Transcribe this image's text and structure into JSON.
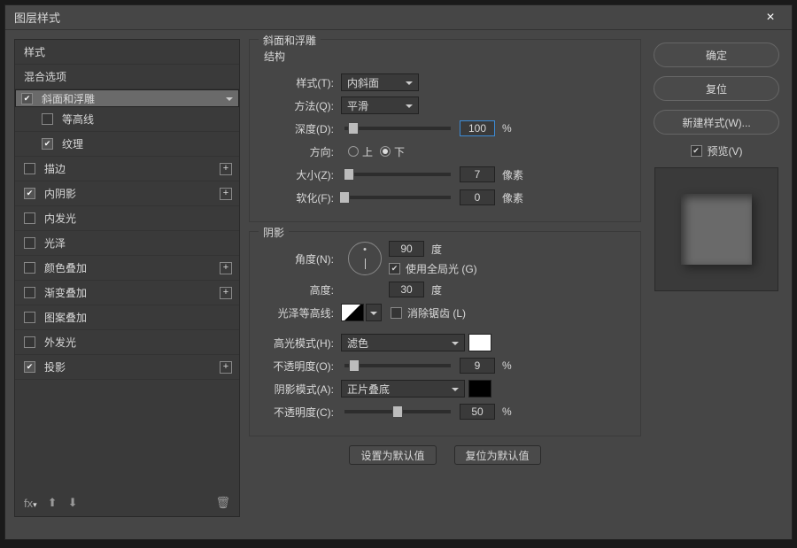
{
  "dialog": {
    "title": "图层样式"
  },
  "left": {
    "style": "样式",
    "blend": "混合选项",
    "bevel": "斜面和浮雕",
    "contour": "等高线",
    "texture": "纹理",
    "stroke": "描边",
    "innerShadow": "内阴影",
    "innerGlow": "内发光",
    "satin": "光泽",
    "colorOverlay": "颜色叠加",
    "gradOverlay": "渐变叠加",
    "pattOverlay": "图案叠加",
    "outerGlow": "外发光",
    "dropShadow": "投影"
  },
  "mid": {
    "groupTitle": "斜面和浮雕",
    "structTitle": "结构",
    "styleLabel": "样式(T):",
    "styleVal": "内斜面",
    "methodLabel": "方法(Q):",
    "methodVal": "平滑",
    "depthLabel": "深度(D):",
    "depthVal": "100",
    "pct": "%",
    "dirLabel": "方向:",
    "up": "上",
    "down": "下",
    "sizeLabel": "大小(Z):",
    "sizeVal": "7",
    "px": "像素",
    "softLabel": "软化(F):",
    "softVal": "0",
    "shadeTitle": "阴影",
    "angleLabel": "角度(N):",
    "angleVal": "90",
    "deg": "度",
    "globalLight": "使用全局光 (G)",
    "altLabel": "高度:",
    "altVal": "30",
    "glossLabel": "光泽等高线:",
    "antiAlias": "消除锯齿 (L)",
    "hiLabel": "高光模式(H):",
    "hiVal": "滤色",
    "hiColor": "#ffffff",
    "hiOpLabel": "不透明度(O):",
    "hiOpVal": "9",
    "shLabel": "阴影模式(A):",
    "shVal": "正片叠底",
    "shColor": "#000000",
    "shOpLabel": "不透明度(C):",
    "shOpVal": "50",
    "setDefault": "设置为默认值",
    "resetDefault": "复位为默认值"
  },
  "right": {
    "ok": "确定",
    "cancel": "复位",
    "newStyle": "新建样式(W)...",
    "preview": "预览(V)"
  }
}
